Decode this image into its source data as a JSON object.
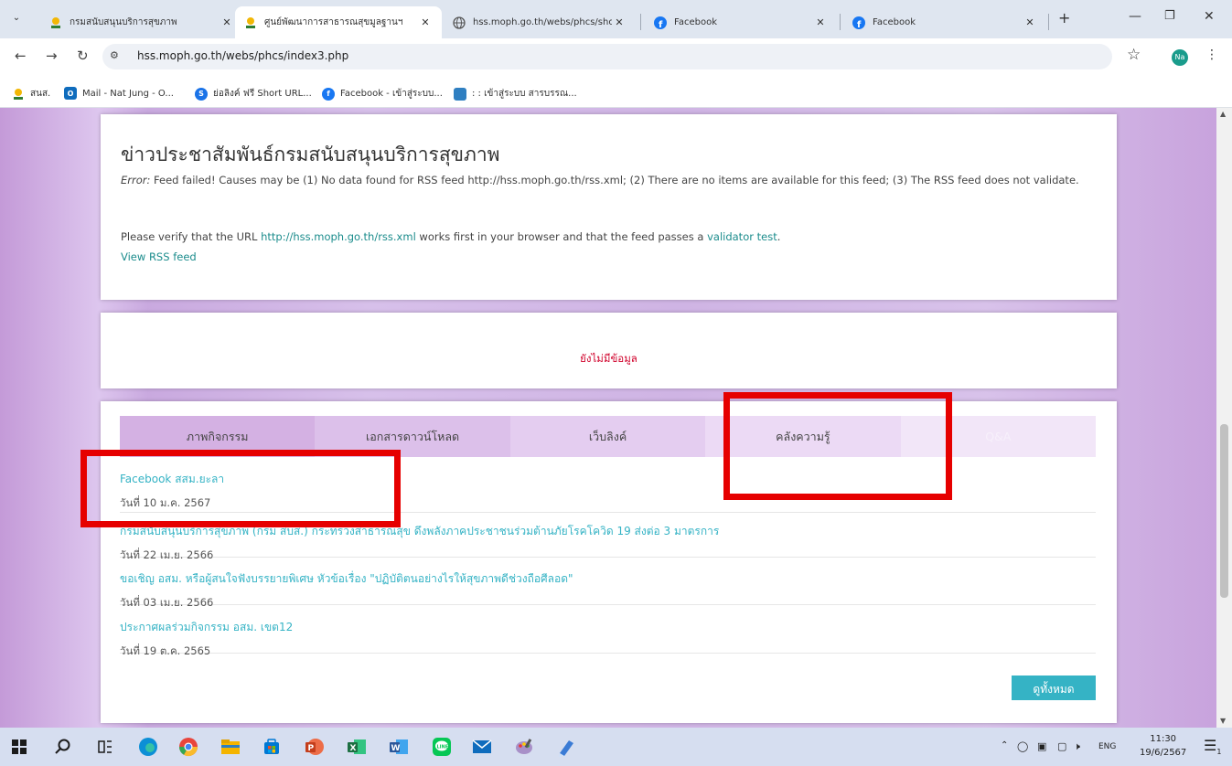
{
  "browser": {
    "tabs": [
      {
        "title": "กรมสนับสนุนบริการสุขภาพ",
        "favicon": "moph-icon",
        "active": false
      },
      {
        "title": "ศูนย์พัฒนาการสาธารณสุขมูลฐานฯ",
        "favicon": "moph-icon",
        "active": true
      },
      {
        "title": "hss.moph.go.th/webs/phcs/sho",
        "favicon": "globe-icon",
        "active": false
      },
      {
        "title": "Facebook",
        "favicon": "facebook-icon",
        "active": false
      },
      {
        "title": "Facebook",
        "favicon": "facebook-icon",
        "active": false
      }
    ],
    "new_tab": "+",
    "url": "hss.moph.go.th/webs/phcs/index3.php",
    "profile_initials": "Na",
    "bookmarks": [
      {
        "label": "สนส.",
        "icon": "moph-icon",
        "color": "#f2b705"
      },
      {
        "label": "Mail - Nat Jung - O...",
        "icon": "outlook-icon",
        "color": "#0f6cbd"
      },
      {
        "label": "ย่อลิงค์ ฟรี Short URL...",
        "icon": "shorturl-icon",
        "color": "#1a73e8"
      },
      {
        "label": "Facebook - เข้าสู่ระบบ...",
        "icon": "facebook-icon",
        "color": "#1877f2"
      },
      {
        "label": ": : เข้าสู่ระบบ สารบรรณ...",
        "icon": "doc-icon",
        "color": "#2f7fc1"
      }
    ]
  },
  "page": {
    "rss": {
      "title": "ข่าวประชาสัมพันธ์กรมสนับสนุนบริการสุขภาพ",
      "error_label": "Error:",
      "error_text": " Feed failed! Causes may be (1) No data found for RSS feed http://hss.moph.go.th/rss.xml; (2) There are no items are available for this feed; (3) The RSS feed does not validate.",
      "verify_prefix": "Please verify that the URL ",
      "verify_url": "http://hss.moph.go.th/rss.xml",
      "verify_middle": " works first in your browser and that the feed passes a ",
      "validator_link": "validator test",
      "verify_suffix": ".",
      "view_feed": "View RSS feed"
    },
    "empty_message": "ยังไม่มีข้อมูล",
    "section_tabs": [
      {
        "label": "ภาพกิจกรรม",
        "bg": "#d4b1e3"
      },
      {
        "label": "เอกสารดาวน์โหลด",
        "bg": "#dcc0ea"
      },
      {
        "label": "เว็บลิงค์",
        "bg": "#e4cdf0"
      },
      {
        "label": "คลังความรู้",
        "bg": "#ecdaf5"
      },
      {
        "label": "Q&A",
        "bg": "#f2e6f8"
      }
    ],
    "news": [
      {
        "title": "Facebook สสม.ยะลา",
        "date": "วันที่ 10 ม.ค. 2567"
      },
      {
        "title": "กรมสนับสนุนบริการสุขภาพ (กรม สบส.) กระทรวงสาธารณสุข ดึงพลังภาคประชาชนร่วมต้านภัยโรคโควิด 19 ส่งต่อ 3 มาตรการ",
        "date": "วันที่ 22 เม.ย. 2566"
      },
      {
        "title": "ขอเชิญ อสม. หรือผู้สนใจฟังบรรยายพิเศษ หัวข้อเรื่อง \"ปฏิบัติตนอย่างไรให้สุขภาพดีช่วงถือศีลอด\"",
        "date": "วันที่ 03 เม.ย. 2566"
      },
      {
        "title": "ประกาศผลร่วมกิจกรรม อสม. เขต12",
        "date": "วันที่ 19 ต.ค. 2565"
      }
    ],
    "view_all": "ดูทั้งหมด"
  },
  "taskbar": {
    "apps": [
      {
        "name": "windows-start-icon",
        "color": "#1b1b1b"
      },
      {
        "name": "search-icon",
        "color": "#1b1b1b"
      },
      {
        "name": "task-view-icon",
        "color": "#1b1b1b"
      },
      {
        "name": "edge-icon",
        "color": "#0c8fd6"
      },
      {
        "name": "chrome-icon",
        "color": "#e8453c"
      },
      {
        "name": "file-explorer-icon",
        "color": "#f4b400"
      },
      {
        "name": "store-icon",
        "color": "#0078d4"
      },
      {
        "name": "powerpoint-icon",
        "color": "#d24726"
      },
      {
        "name": "excel-icon",
        "color": "#1d6f42"
      },
      {
        "name": "word-icon",
        "color": "#2b579a"
      },
      {
        "name": "line-icon",
        "color": "#06c755"
      },
      {
        "name": "mail-icon",
        "color": "#0f6cbd"
      },
      {
        "name": "paint-icon",
        "color": "#7a5aa6"
      },
      {
        "name": "notepad-icon",
        "color": "#3a7bd5"
      }
    ],
    "language": "ENG",
    "time": "11:30",
    "date": "19/6/2567",
    "notification_count": "1"
  }
}
